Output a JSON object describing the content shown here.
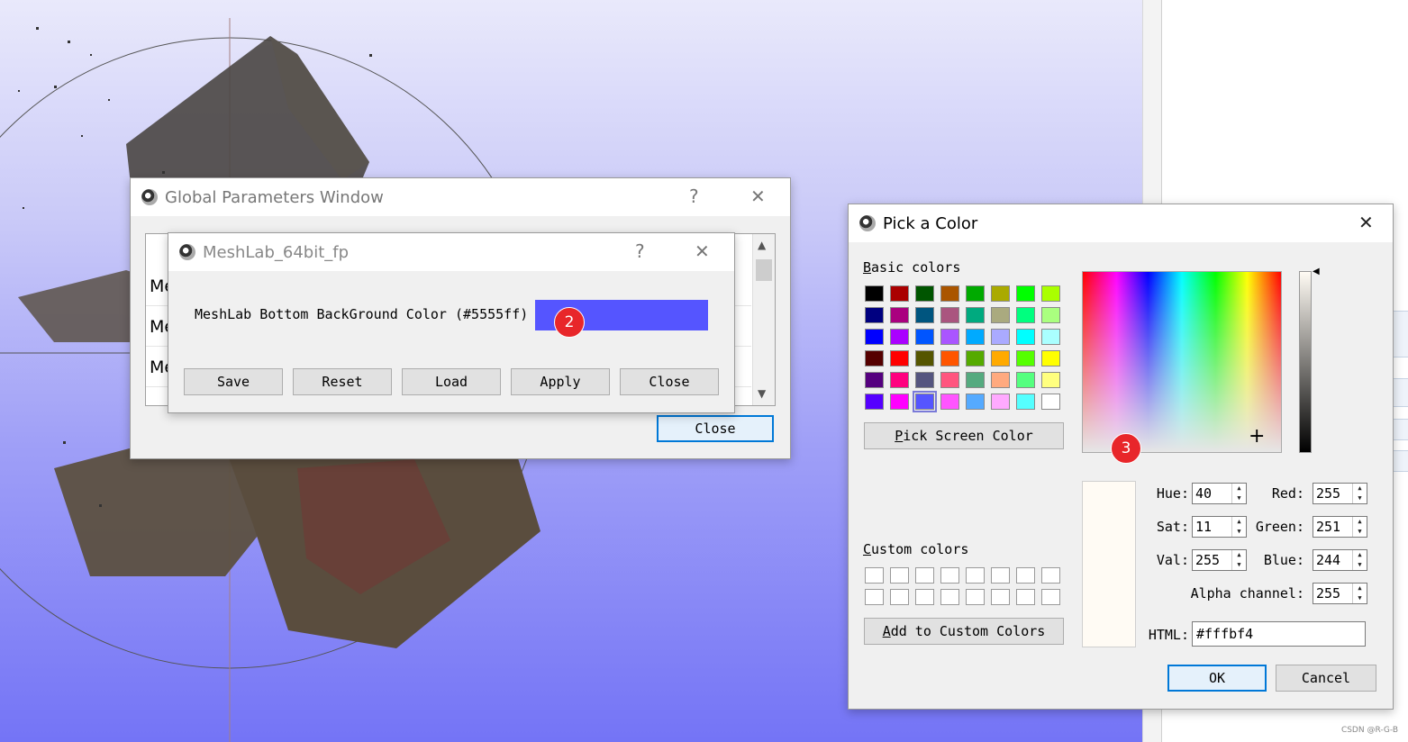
{
  "viewport": {
    "background_top": "#e9e9fb",
    "background_bottom": "#7474f6"
  },
  "global_window": {
    "title": "Global Parameters Window",
    "help_glyph": "?",
    "close_glyph": "✕",
    "rows": [
      "Me",
      "Me",
      "Me"
    ],
    "close_button": "Close"
  },
  "meshlab_dialog": {
    "title": "MeshLab_64bit_fp",
    "help_glyph": "?",
    "close_glyph": "✕",
    "param_label": "MeshLab Bottom BackGround Color (#5555ff)",
    "swatch_color": "#5555ff",
    "buttons": [
      "Save",
      "Reset",
      "Load",
      "Apply",
      "Close"
    ]
  },
  "badges": {
    "two": "2",
    "three": "3"
  },
  "color_dialog": {
    "title": "Pick a Color",
    "close_glyph": "✕",
    "basic_colors_label": "asic colors",
    "basic_colors_key": "B",
    "basic_colors": [
      "#000000",
      "#aa0000",
      "#005500",
      "#aa5500",
      "#00aa00",
      "#aaaa00",
      "#00ff00",
      "#aaff00",
      "#000080",
      "#aa007f",
      "#00557f",
      "#aa557f",
      "#00aa7f",
      "#aaaa7f",
      "#00ff7f",
      "#aaff7f",
      "#0000ff",
      "#aa00ff",
      "#0055ff",
      "#aa55ff",
      "#00aaff",
      "#aaaaff",
      "#00ffff",
      "#aaffff",
      "#550000",
      "#ff0000",
      "#555500",
      "#ff5500",
      "#55aa00",
      "#ffaa00",
      "#55ff00",
      "#ffff00",
      "#55007f",
      "#ff007f",
      "#55557f",
      "#ff557f",
      "#55aa7f",
      "#ffaa7f",
      "#55ff7f",
      "#ffff7f",
      "#5500ff",
      "#ff00ff",
      "#5555ff",
      "#ff55ff",
      "#55aaff",
      "#ffaaff",
      "#55ffff",
      "#ffffff"
    ],
    "selected_index": 42,
    "pick_screen_key": "P",
    "pick_screen_label": "ick Screen Color",
    "custom_colors_key": "C",
    "custom_colors_label": "ustom colors",
    "add_custom_key": "A",
    "add_custom_label": "dd to Custom Colors",
    "preview_color": "#fffbf4",
    "fields": {
      "hue": {
        "label": "Hue:",
        "value": "40"
      },
      "sat": {
        "label": "Sat:",
        "value": "11"
      },
      "val": {
        "label": "Val:",
        "value": "255"
      },
      "red": {
        "label": "Red:",
        "value": "255"
      },
      "green": {
        "label": "Green:",
        "value": "251"
      },
      "blue": {
        "label": "Blue:",
        "value": "244"
      },
      "alpha": {
        "label": "Alpha channel:",
        "value": "255"
      },
      "html": {
        "label": "HTML:",
        "value": "#fffbf4"
      }
    },
    "ok_button": "OK",
    "cancel_button": "Cancel"
  },
  "watermark": "CSDN @R-G-B"
}
